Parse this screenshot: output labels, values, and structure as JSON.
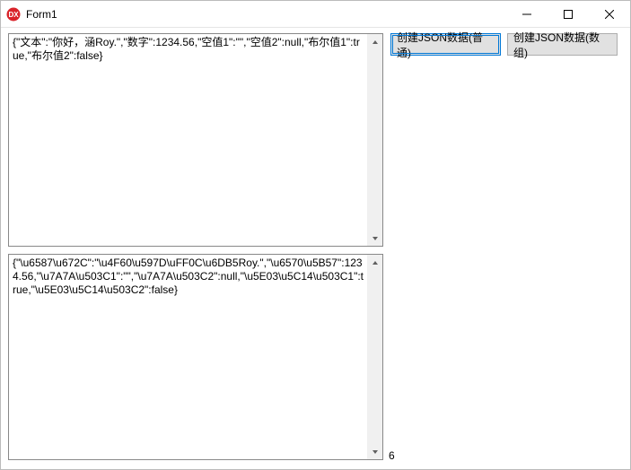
{
  "window": {
    "title": "Form1"
  },
  "memo1": {
    "text": "{\"文本\":\"你好，涵Roy.\",\"数字\":1234.56,\"空值1\":\"\",\"空值2\":null,\"布尔值1\":true,\"布尔值2\":false}"
  },
  "memo2": {
    "text": "{\"\\u6587\\u672C\":\"\\u4F60\\u597D\\uFF0C\\u6DB5Roy.\",\"\\u6570\\u5B57\":1234.56,\"\\u7A7A\\u503C1\":\"\",\"\\u7A7A\\u503C2\":null,\"\\u5E03\\u5C14\\u503C1\":true,\"\\u5E03\\u5C14\\u503C2\":false}"
  },
  "buttons": {
    "create_json_normal": "创建JSON数据(普通)",
    "create_json_array": "创建JSON数据(数组)"
  },
  "label": {
    "six": "6"
  }
}
